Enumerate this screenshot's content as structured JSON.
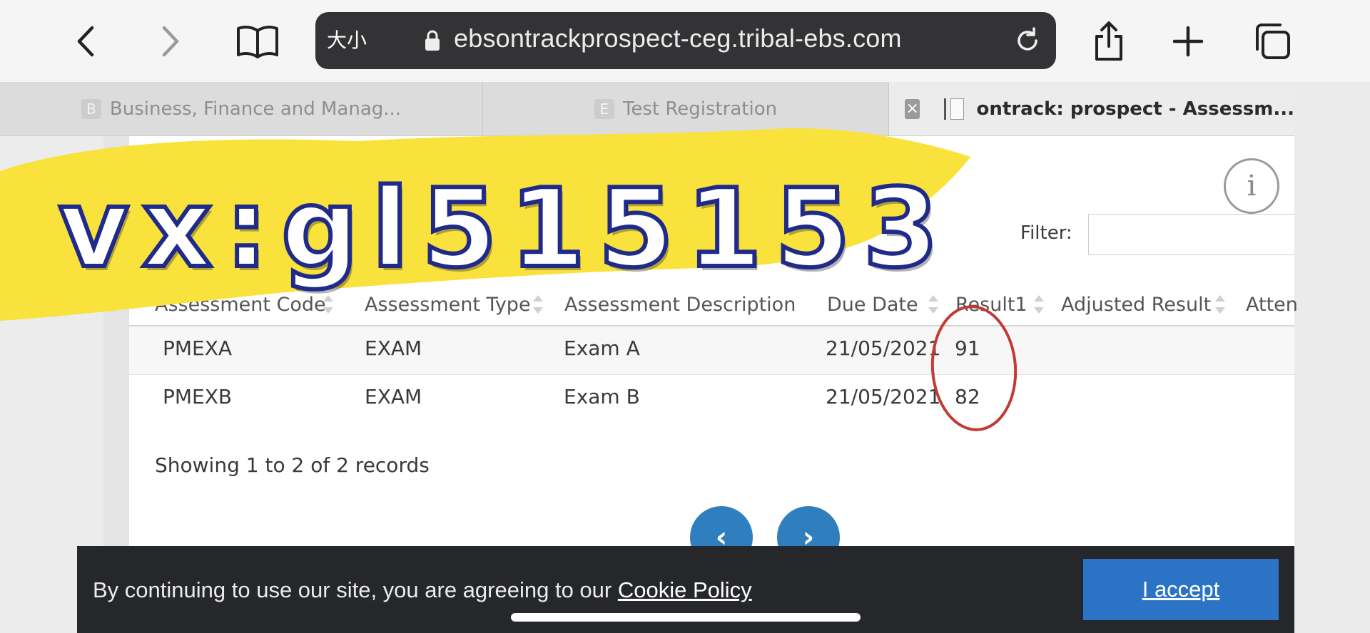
{
  "browser": {
    "url_size_label": "大小",
    "url": "ebsontrackprospect-ceg.tribal-ebs.com"
  },
  "tabs": [
    {
      "favicon": "B",
      "label": "Business, Finance and Manag..."
    },
    {
      "favicon": "E",
      "label": "Test Registration"
    },
    {
      "label": "ontrack: prospect - Assessm..."
    }
  ],
  "filter": {
    "label": "Filter:"
  },
  "table": {
    "headers": [
      "Assessment Code",
      "Assessment Type",
      "Assessment Description",
      "Due Date",
      "Result1",
      "Adjusted Result",
      "Atten"
    ],
    "rows": [
      {
        "code": "PMEXA",
        "type": "EXAM",
        "description": "Exam A",
        "due_date": "21/05/2021",
        "result1": "91"
      },
      {
        "code": "PMEXB",
        "type": "EXAM",
        "description": "Exam B",
        "due_date": "21/05/2021",
        "result1": "82"
      }
    ]
  },
  "records_text": "Showing 1 to 2 of 2 records",
  "pager": {
    "prev": "‹",
    "next": "›"
  },
  "watermark": "vx:gl515153",
  "cookie": {
    "message": "By continuing to use our site, you are agreeing to our ",
    "link": "Cookie Policy",
    "accept": "I accept"
  },
  "info_symbol": "i",
  "tab_close_symbol": "×",
  "colors": {
    "accent": "#2a73c5",
    "pager": "#2f7fbf",
    "highlight": "#c23a32",
    "watermark_fill": "#f9e23b",
    "watermark_outline": "#1f2a8a"
  }
}
